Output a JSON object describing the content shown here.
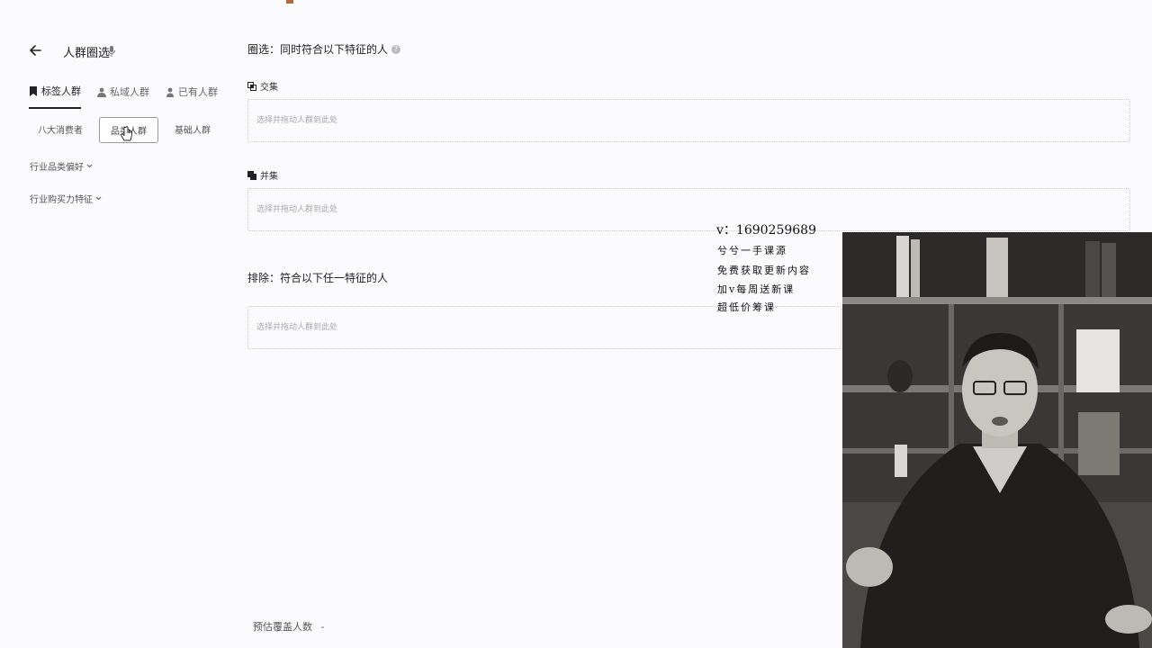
{
  "panel": {
    "title": "人群圈选",
    "tabs": [
      {
        "label": "标签人群",
        "icon": "bookmark-icon",
        "active": true
      },
      {
        "label": "私域人群",
        "icon": "people-icon",
        "active": false
      },
      {
        "label": "已有人群",
        "icon": "person-icon",
        "active": false
      }
    ],
    "chips": [
      {
        "label": "八大消费者",
        "active": false
      },
      {
        "label": "品类人群",
        "active": true
      },
      {
        "label": "基础人群",
        "active": false
      }
    ],
    "categories": [
      {
        "label": "行业品类偏好"
      },
      {
        "label": "行业购买力特征"
      }
    ]
  },
  "main": {
    "title": "圈选：同时符合以下特征的人",
    "intersection": {
      "label": "交集",
      "placeholder": "选择并拖动人群到此处"
    },
    "union": {
      "label": "并集",
      "placeholder": "选择并拖动人群到此处"
    },
    "exclude": {
      "title": "排除：符合以下任一特征的人",
      "placeholder": "选择并拖动人群到此处"
    }
  },
  "footer": {
    "estimate_label": "预估覆盖人数",
    "estimate_value": "-"
  },
  "overlay": {
    "contact": "v：1690259689",
    "lines": [
      "兮兮一手课源",
      "免费获取更新内容",
      "加v每周送新课",
      "超低价筹课"
    ]
  },
  "colors": {
    "background": "#fbfbfd",
    "text": "#222222",
    "dropzone_border": "#c9c9cf"
  }
}
